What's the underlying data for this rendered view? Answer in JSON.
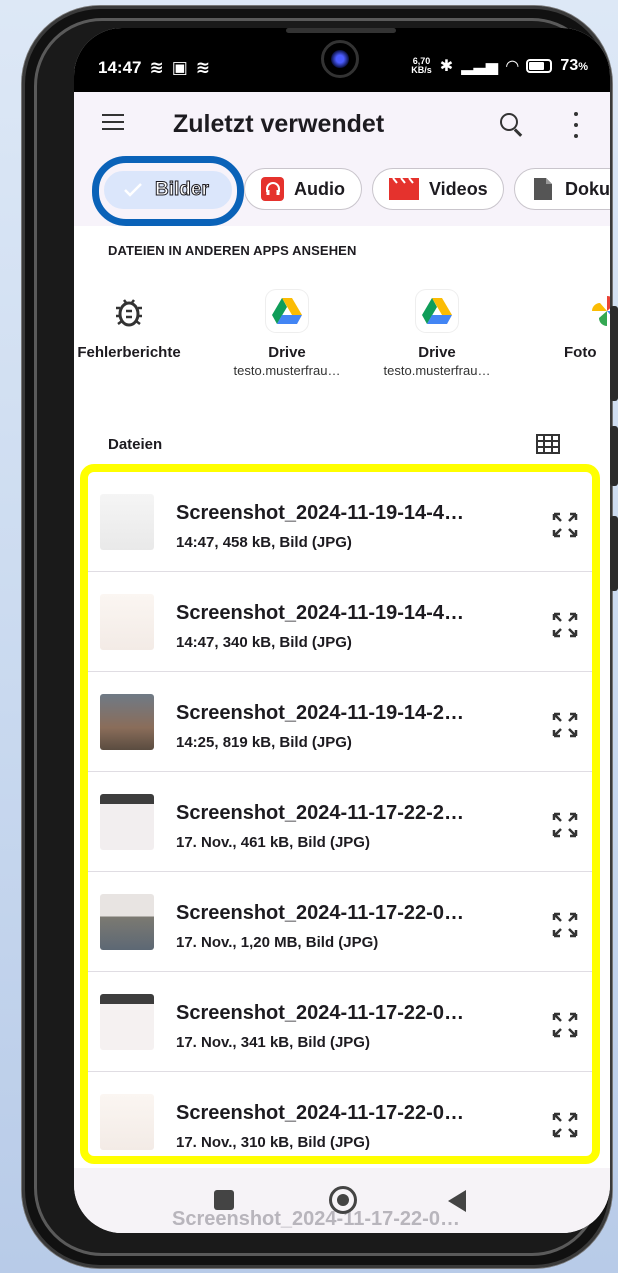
{
  "status_bar": {
    "time": "14:47",
    "net_speed_top": "6,70",
    "net_speed_bottom": "KB/s",
    "battery": "73",
    "battery_unit": "%"
  },
  "app_bar": {
    "title": "Zuletzt verwendet",
    "menu_icon": "hamburger-menu-icon",
    "search_icon": "search-icon",
    "more_icon": "more-vert-icon"
  },
  "filter_chips": [
    {
      "label": "Bilder",
      "icon": "check-icon",
      "selected": true
    },
    {
      "label": "Audio",
      "icon": "headphones-icon",
      "selected": false
    },
    {
      "label": "Videos",
      "icon": "clapperboard-icon",
      "selected": false
    },
    {
      "label": "Doku",
      "icon": "document-icon",
      "selected": false
    }
  ],
  "other_apps": {
    "title": "DATEIEN IN ANDEREN APPS ANSEHEN",
    "items": [
      {
        "name": "Fehlerberichte",
        "sub": "",
        "icon": "bug-icon"
      },
      {
        "name": "Drive",
        "sub": "testo.musterfrau…",
        "icon": "google-drive-icon"
      },
      {
        "name": "Drive",
        "sub": "testo.musterfrau…",
        "icon": "google-drive-icon"
      },
      {
        "name": "Foto",
        "sub": "",
        "icon": "google-photos-icon"
      }
    ]
  },
  "files": {
    "header": "Dateien",
    "view_icon": "grid-view-icon",
    "items": [
      {
        "name": "Screenshot_2024-11-19-14-4…",
        "meta": "14:47, 458 kB, Bild (JPG)"
      },
      {
        "name": "Screenshot_2024-11-19-14-4…",
        "meta": "14:47, 340 kB, Bild (JPG)"
      },
      {
        "name": "Screenshot_2024-11-19-14-2…",
        "meta": "14:25, 819 kB, Bild (JPG)"
      },
      {
        "name": "Screenshot_2024-11-17-22-2…",
        "meta": "17. Nov., 461 kB, Bild (JPG)"
      },
      {
        "name": "Screenshot_2024-11-17-22-0…",
        "meta": "17. Nov., 1,20 MB, Bild (JPG)"
      },
      {
        "name": "Screenshot_2024-11-17-22-0…",
        "meta": "17. Nov., 341 kB, Bild (JPG)"
      },
      {
        "name": "Screenshot_2024-11-17-22-0…",
        "meta": "17. Nov., 310 kB, Bild (JPG)"
      }
    ],
    "peek_item": "Screenshot_2024-11-17-22-0…"
  },
  "colors": {
    "highlight_chip_border": "#0a62b8",
    "highlight_list_border": "#ffff00",
    "selected_chip_bg": "#dbe6fb",
    "audio_red": "#e5322d",
    "videos_red": "#e5322d"
  }
}
